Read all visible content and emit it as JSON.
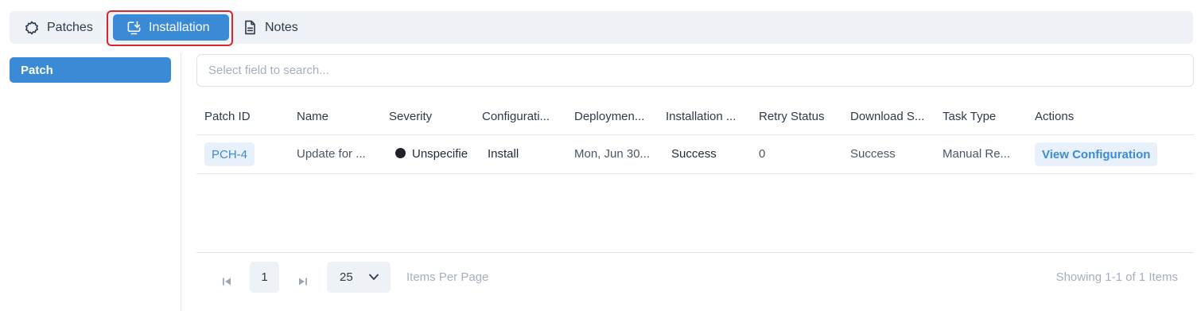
{
  "tabs": [
    {
      "label": "Patches",
      "icon": "gear-icon",
      "active": false
    },
    {
      "label": "Installation",
      "icon": "install-icon",
      "active": true
    },
    {
      "label": "Notes",
      "icon": "document-icon",
      "active": false
    }
  ],
  "sidebar": {
    "items": [
      {
        "label": "Patch",
        "active": true
      }
    ]
  },
  "search": {
    "placeholder": "Select field to search..."
  },
  "table": {
    "columns": [
      "Patch ID",
      "Name",
      "Severity",
      "Configurati...",
      "Deploymen...",
      "Installation ...",
      "Retry Status",
      "Download S...",
      "Task Type",
      "Actions"
    ],
    "rows": [
      {
        "patch_id": "PCH-4",
        "name": "Update for ...",
        "severity": "Unspecifie",
        "configuration": "Install",
        "deployment": "Mon, Jun 30...",
        "installation": "Success",
        "retry_status": "0",
        "download_status": "Success",
        "task_type": "Manual Re...",
        "action_label": "View Configuration"
      }
    ]
  },
  "pagination": {
    "current_page": "1",
    "page_size": "25",
    "items_per_page_label": "Items Per Page",
    "showing": "Showing 1-1 of 1 Items"
  },
  "colors": {
    "accent": "#3b8ad6",
    "highlight": "#d8262c",
    "tabbar_bg": "#eef1f6"
  }
}
